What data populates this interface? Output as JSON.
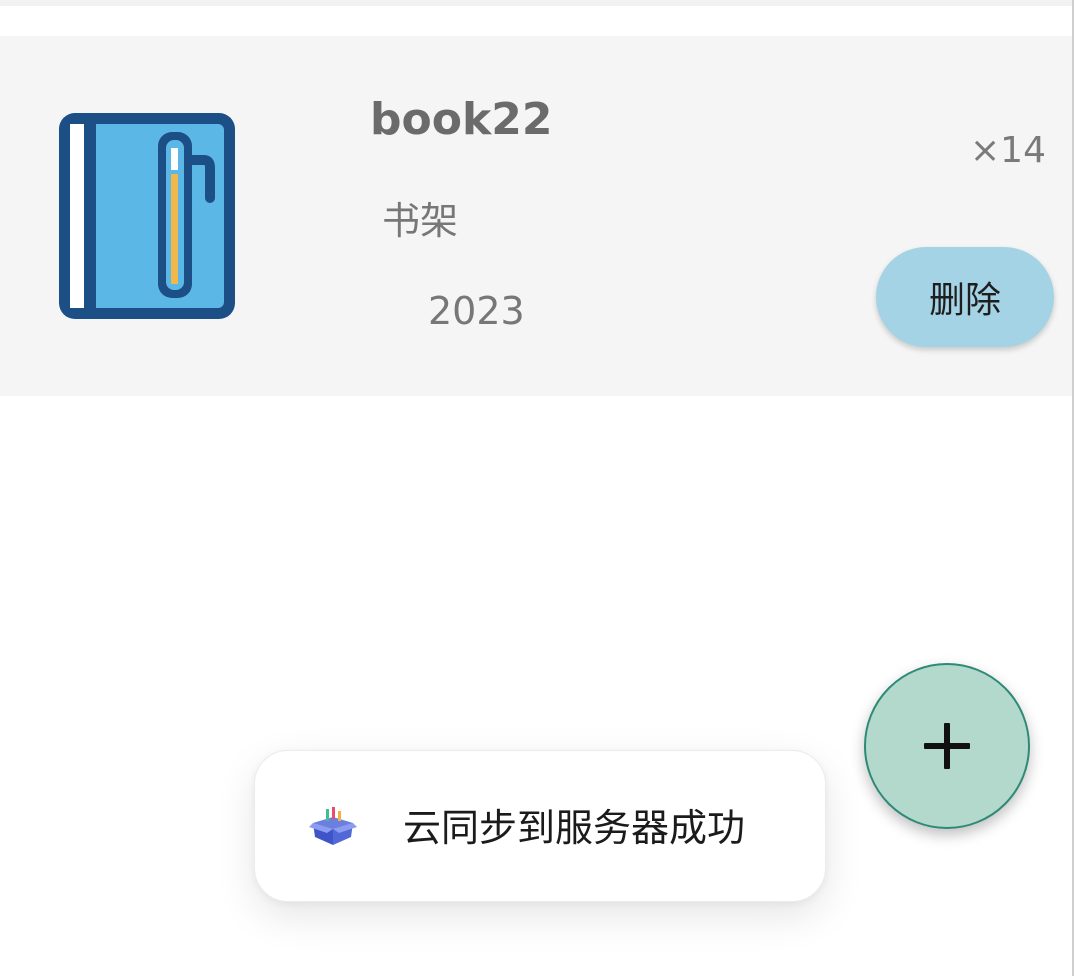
{
  "book_item": {
    "title": "book22",
    "category": "书架",
    "year": "2023",
    "count": "×14",
    "delete_label": "删除",
    "icon": "notebook-icon"
  },
  "fab": {
    "icon": "plus-icon"
  },
  "toast": {
    "message": "云同步到服务器成功",
    "icon": "cloud-sync-box-icon"
  },
  "colors": {
    "card_background": "#f5f5f5",
    "delete_button": "#a4d3e5",
    "fab_background": "#b2d9cc",
    "fab_border": "#2e8a77",
    "book_icon_blue": "#5bb8e6",
    "book_icon_dark": "#1c4f86",
    "book_icon_accent": "#f2b84b"
  }
}
